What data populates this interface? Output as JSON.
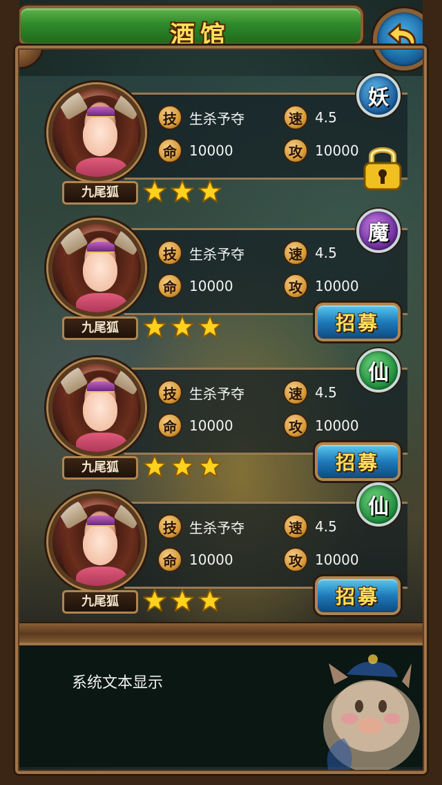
{
  "header": {
    "title": "酒馆",
    "back_icon": "back-arrow-icon"
  },
  "colors": {
    "title_bar": "#2f8a2a",
    "title_text": "#ffe05a",
    "frame": "#3b2616",
    "recruit_button": "#1e7ab8",
    "faction_yao": "#1a5a9a",
    "faction_mo": "#6a2a9a",
    "faction_xian": "#1e8a3a"
  },
  "heroes": [
    {
      "name": "九尾狐",
      "stars": 3,
      "faction": "妖",
      "faction_color": "blue",
      "skill_label": "技",
      "skill": "生杀予夺",
      "speed_label": "速",
      "speed": "4.5",
      "hp_label": "命",
      "hp": "10000",
      "attack_label": "攻",
      "attack": "10000",
      "locked": true
    },
    {
      "name": "九尾狐",
      "stars": 3,
      "faction": "魔",
      "faction_color": "purple",
      "skill_label": "技",
      "skill": "生杀予夺",
      "speed_label": "速",
      "speed": "4.5",
      "hp_label": "命",
      "hp": "10000",
      "attack_label": "攻",
      "attack": "10000",
      "action_label": "招募"
    },
    {
      "name": "九尾狐",
      "stars": 3,
      "faction": "仙",
      "faction_color": "green",
      "skill_label": "技",
      "skill": "生杀予夺",
      "speed_label": "速",
      "speed": "4.5",
      "hp_label": "命",
      "hp": "10000",
      "attack_label": "攻",
      "attack": "10000",
      "action_label": "招募"
    },
    {
      "name": "九尾狐",
      "stars": 3,
      "faction": "仙",
      "faction_color": "green",
      "skill_label": "技",
      "skill": "生杀予夺",
      "speed_label": "速",
      "speed": "4.5",
      "hp_label": "命",
      "hp": "10000",
      "attack_label": "攻",
      "attack": "10000",
      "action_label": "招募"
    }
  ],
  "message": {
    "text": "系统文本显示"
  }
}
